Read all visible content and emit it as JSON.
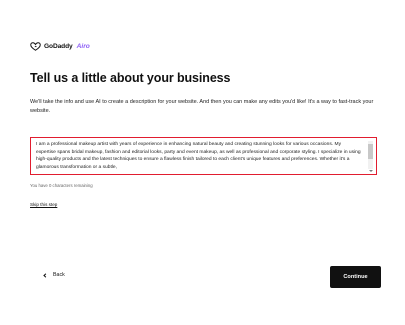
{
  "brand": {
    "name": "GoDaddy",
    "product": "Airo"
  },
  "page": {
    "title": "Tell us a little about your business",
    "intro": "We'll take the info and use AI to create a description for your website. And then you can make any edits you'd like! It's a way to fast-track your website."
  },
  "description": {
    "value": "I am a professional makeup artist with years of experience in enhancing natural beauty and creating stunning looks for various occasions. My expertise spans bridal makeup, fashion and editorial looks, party and event makeup, as well as professional and corporate styling. I specialize in using high-quality products and the latest techniques to ensure a flawless finish tailored to each client's unique features and preferences. Whether it's a glamorous transformation or a subtle,",
    "highlight_color": "#e11d2f"
  },
  "char_counter": "You have 0 characters remaining",
  "skip_link": "Skip this step",
  "nav": {
    "back_label": "Back",
    "continue_label": "Continue"
  },
  "colors": {
    "accent": "#8b5cf6",
    "primary_button": "#111111"
  }
}
